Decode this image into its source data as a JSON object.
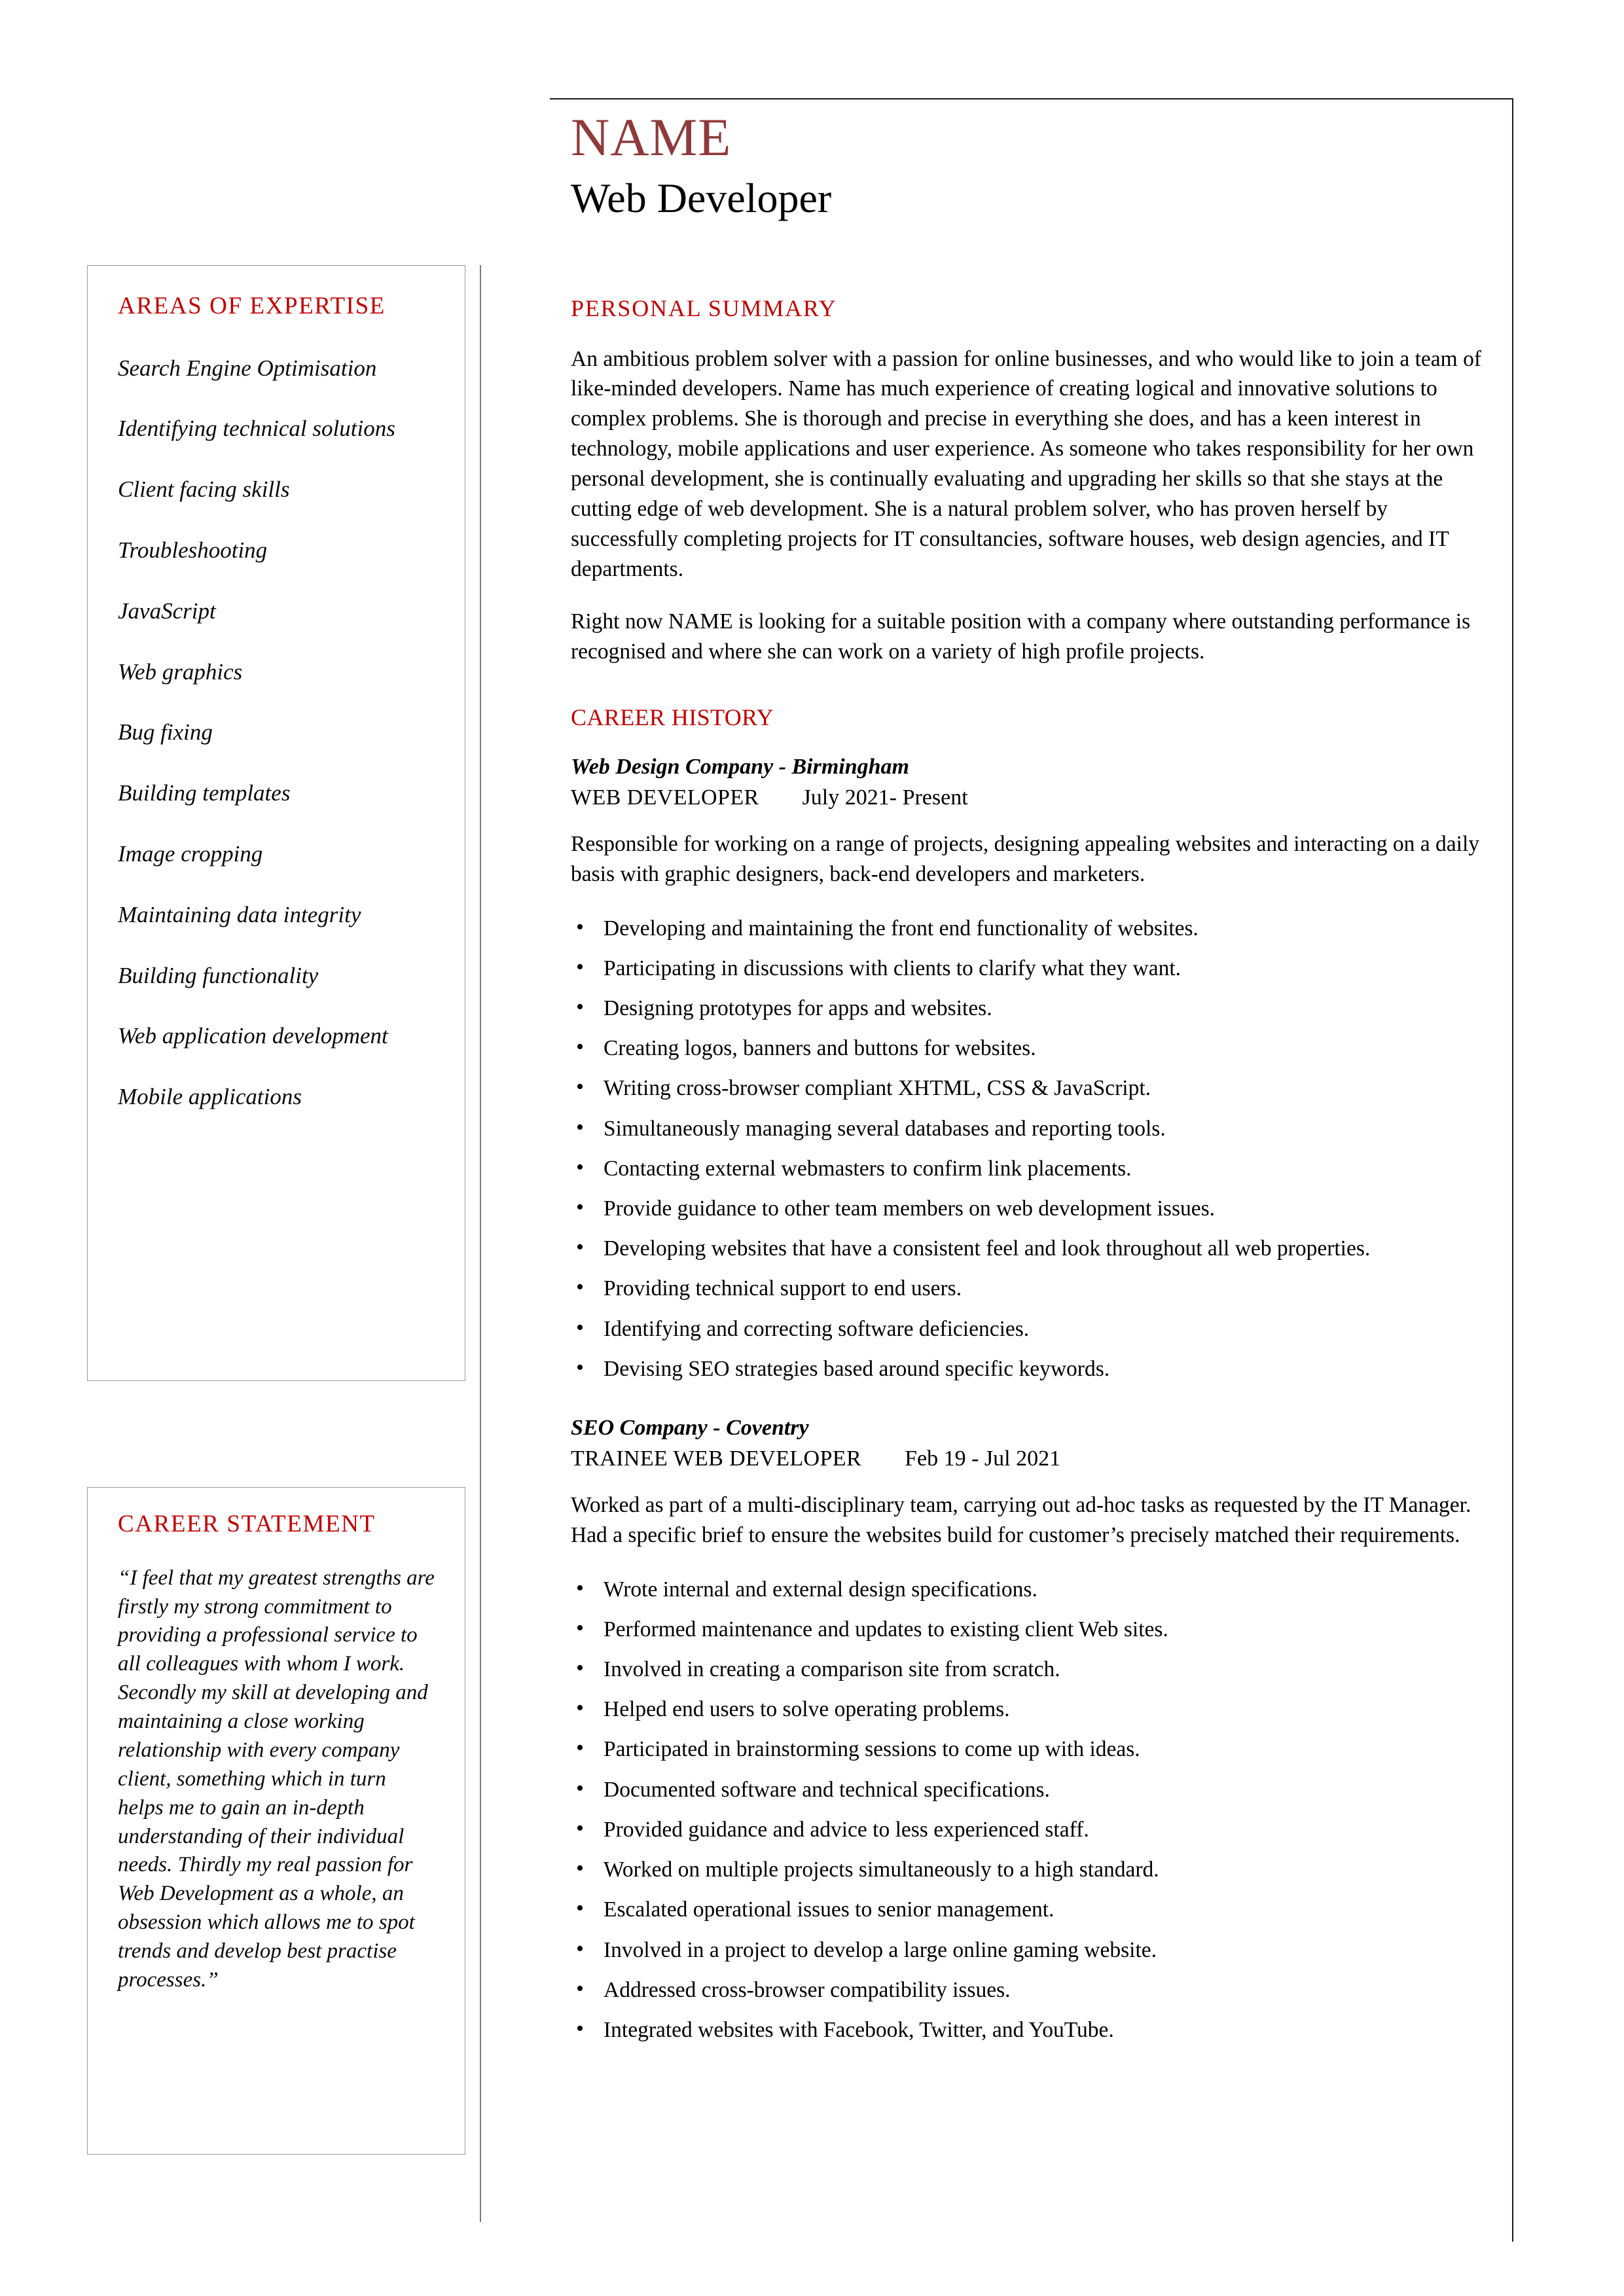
{
  "colors": {
    "name_red": "#8F3A3A",
    "heading_red": "#C00000",
    "text_black": "#000000",
    "border_gray": "#9A9A9A"
  },
  "header": {
    "name": "NAME",
    "job_title": "Web Developer"
  },
  "sidebar": {
    "expertise": {
      "heading": "AREAS OF EXPERTISE",
      "items": [
        "Search Engine Optimisation",
        "Identifying technical solutions",
        "Client facing skills",
        "Troubleshooting",
        "JavaScript",
        "Web graphics",
        "Bug fixing",
        "Building templates",
        "Image cropping",
        "Maintaining data integrity",
        "Building functionality",
        "Web application development",
        "Mobile applications"
      ]
    },
    "career_statement": {
      "heading": "CAREER STATEMENT",
      "text": "“I feel that my greatest strengths are firstly my strong commitment to providing a professional service to all colleagues with whom I work. Secondly my skill at developing and maintaining a close working relationship with every company client, something which in turn helps me to gain an in-depth  understanding of their individual needs.  Thirdly my real passion for Web Development as a whole, an obsession which allows me to spot trends and develop best practise processes.”"
    }
  },
  "main": {
    "personal_summary": {
      "heading": "PERSONAL SUMMARY",
      "paragraph_1": "An ambitious problem solver with a passion for online businesses, and who would like to join a team of like-minded developers. Name has much experience of creating logical and innovative solutions to complex problems. She is thorough and precise in everything she does, and has a keen interest in technology, mobile applications and user experience. As someone who takes responsibility for her own personal development, she is continually evaluating and upgrading her skills so that she stays at the cutting edge of web development. She is a natural problem solver, who has proven herself by successfully completing projects for IT consultancies, software houses, web design agencies, and IT departments.",
      "paragraph_2": "Right now NAME is looking for a suitable position with a company where outstanding performance is recognised and where she can work on a variety of high profile projects."
    },
    "career_history": {
      "heading": "CAREER HISTORY",
      "jobs": [
        {
          "company": "Web Design Company - Birmingham",
          "role": "WEB DEVELOPER",
          "dates": "July 2021- Present",
          "summary": "Responsible for working on a range of projects, designing appealing websites and interacting on a daily basis with graphic designers, back-end developers and marketers.",
          "duties": [
            "Developing and maintaining the front end functionality of websites.",
            "Participating in discussions with clients to clarify what they want.",
            "Designing prototypes for apps and websites.",
            "Creating logos, banners and buttons for websites.",
            "Writing cross-browser compliant XHTML, CSS & JavaScript.",
            "Simultaneously managing several databases and reporting tools.",
            "Contacting external webmasters to confirm link placements.",
            "Provide guidance to other team members on web development issues.",
            "Developing websites that have a consistent feel and look throughout all web properties.",
            "Providing technical support to end users.",
            "Identifying and correcting software deficiencies.",
            "Devising SEO strategies based around specific keywords."
          ]
        },
        {
          "company": "SEO Company - Coventry",
          "role": "TRAINEE WEB DEVELOPER",
          "dates": "Feb 19 - Jul 2021",
          "summary": "Worked as part of a multi-disciplinary team, carrying out ad-hoc tasks as requested by the IT Manager. Had a specific brief to ensure the websites build for customer’s precisely matched their requirements.",
          "duties": [
            "Wrote internal and external design specifications.",
            "Performed maintenance and updates to existing client Web sites.",
            "Involved in creating a comparison site from scratch.",
            "Helped end users to solve operating problems.",
            "Participated in brainstorming sessions to come up with ideas.",
            "Documented software and technical specifications.",
            "Provided guidance and advice to less experienced staff.",
            "Worked on multiple projects simultaneously to a high standard.",
            "Escalated operational issues to senior management.",
            "Involved in a project to develop a large online gaming website.",
            "Addressed cross-browser compatibility issues.",
            "Integrated websites with Facebook, Twitter, and YouTube."
          ]
        }
      ]
    }
  }
}
